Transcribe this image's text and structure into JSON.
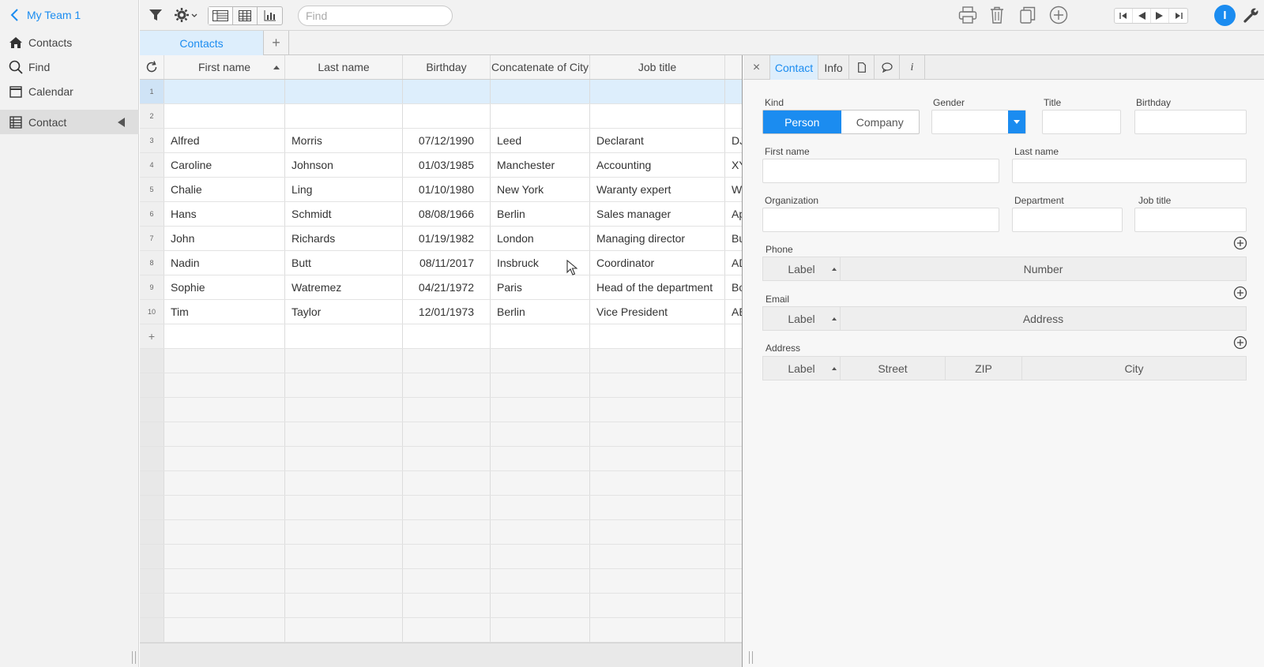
{
  "sidebar": {
    "team": "My Team 1",
    "items": [
      {
        "label": "Contacts",
        "icon": "home-icon"
      },
      {
        "label": "Find",
        "icon": "search-icon"
      },
      {
        "label": "Calendar",
        "icon": "calendar-icon"
      },
      {
        "label": "Contact",
        "icon": "table-icon"
      }
    ]
  },
  "toolbar": {
    "find_placeholder": "Find",
    "user_initial": "I"
  },
  "tabs": {
    "view_tab": "Contacts",
    "add_tab": "+"
  },
  "grid": {
    "columns": [
      "First name",
      "Last name",
      "Birthday",
      "Concatenate of City",
      "Job title"
    ],
    "rows": [
      {
        "n": "1",
        "first": "",
        "last": "",
        "birthday": "",
        "city": "",
        "job": "",
        "extra": ""
      },
      {
        "n": "2",
        "first": "",
        "last": "",
        "birthday": "",
        "city": "",
        "job": "",
        "extra": ""
      },
      {
        "n": "3",
        "first": "Alfred",
        "last": "Morris",
        "birthday": "07/12/1990",
        "city": "Leed",
        "job": "Declarant",
        "extra": "DJ"
      },
      {
        "n": "4",
        "first": "Caroline",
        "last": "Johnson",
        "birthday": "01/03/1985",
        "city": "Manchester",
        "job": "Accounting",
        "extra": "XY"
      },
      {
        "n": "5",
        "first": "Chalie",
        "last": "Ling",
        "birthday": "01/10/1980",
        "city": "New York",
        "job": "Waranty expert",
        "extra": "Wa"
      },
      {
        "n": "6",
        "first": "Hans",
        "last": "Schmidt",
        "birthday": "08/08/1966",
        "city": "Berlin",
        "job": "Sales manager",
        "extra": "Ap"
      },
      {
        "n": "7",
        "first": "John",
        "last": "Richards",
        "birthday": "01/19/1982",
        "city": "London",
        "job": "Managing director",
        "extra": "Bu"
      },
      {
        "n": "8",
        "first": "Nadin",
        "last": "Butt",
        "birthday": "08/11/2017",
        "city": "Insbruck",
        "job": "Coordinator",
        "extra": "AD"
      },
      {
        "n": "9",
        "first": "Sophie",
        "last": "Watremez",
        "birthday": "04/21/1972",
        "city": "Paris",
        "job": "Head of the department",
        "extra": "Bo"
      },
      {
        "n": "10",
        "first": "Tim",
        "last": "Taylor",
        "birthday": "12/01/1973",
        "city": "Berlin",
        "job": "Vice President",
        "extra": "AE"
      }
    ],
    "add_row": "+"
  },
  "detail": {
    "tabs": {
      "close": "×",
      "contact": "Contact",
      "info": "Info",
      "i": "i"
    },
    "kind": {
      "label": "Kind",
      "options": [
        "Person",
        "Company"
      ],
      "selected": "Person"
    },
    "gender": {
      "label": "Gender",
      "value": ""
    },
    "title": {
      "label": "Title",
      "value": ""
    },
    "birthday": {
      "label": "Birthday",
      "value": ""
    },
    "first_name": {
      "label": "First name",
      "value": ""
    },
    "last_name": {
      "label": "Last name",
      "value": ""
    },
    "organization": {
      "label": "Organization",
      "value": ""
    },
    "department": {
      "label": "Department",
      "value": ""
    },
    "job_title": {
      "label": "Job title",
      "value": ""
    },
    "phone": {
      "label": "Phone",
      "columns": [
        "Label",
        "Number"
      ]
    },
    "email": {
      "label": "Email",
      "columns": [
        "Label",
        "Address"
      ]
    },
    "address": {
      "label": "Address",
      "columns": [
        "Label",
        "Street",
        "ZIP",
        "City"
      ]
    }
  },
  "colors": {
    "accent": "#1b8cf0",
    "selected_row": "#ddeefc"
  }
}
